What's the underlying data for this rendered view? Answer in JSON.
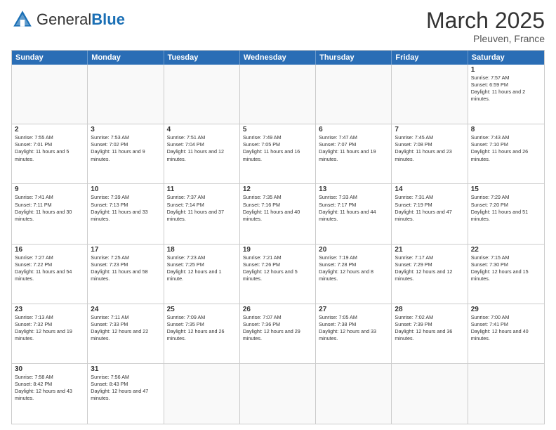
{
  "header": {
    "logo_general": "General",
    "logo_blue": "Blue",
    "month": "March 2025",
    "location": "Pleuven, France"
  },
  "days_of_week": [
    "Sunday",
    "Monday",
    "Tuesday",
    "Wednesday",
    "Thursday",
    "Friday",
    "Saturday"
  ],
  "weeks": [
    [
      {
        "day": "",
        "text": ""
      },
      {
        "day": "",
        "text": ""
      },
      {
        "day": "",
        "text": ""
      },
      {
        "day": "",
        "text": ""
      },
      {
        "day": "",
        "text": ""
      },
      {
        "day": "",
        "text": ""
      },
      {
        "day": "1",
        "text": "Sunrise: 7:57 AM\nSunset: 6:59 PM\nDaylight: 11 hours and 2 minutes."
      }
    ],
    [
      {
        "day": "2",
        "text": "Sunrise: 7:55 AM\nSunset: 7:01 PM\nDaylight: 11 hours and 5 minutes."
      },
      {
        "day": "3",
        "text": "Sunrise: 7:53 AM\nSunset: 7:02 PM\nDaylight: 11 hours and 9 minutes."
      },
      {
        "day": "4",
        "text": "Sunrise: 7:51 AM\nSunset: 7:04 PM\nDaylight: 11 hours and 12 minutes."
      },
      {
        "day": "5",
        "text": "Sunrise: 7:49 AM\nSunset: 7:05 PM\nDaylight: 11 hours and 16 minutes."
      },
      {
        "day": "6",
        "text": "Sunrise: 7:47 AM\nSunset: 7:07 PM\nDaylight: 11 hours and 19 minutes."
      },
      {
        "day": "7",
        "text": "Sunrise: 7:45 AM\nSunset: 7:08 PM\nDaylight: 11 hours and 23 minutes."
      },
      {
        "day": "8",
        "text": "Sunrise: 7:43 AM\nSunset: 7:10 PM\nDaylight: 11 hours and 26 minutes."
      }
    ],
    [
      {
        "day": "9",
        "text": "Sunrise: 7:41 AM\nSunset: 7:11 PM\nDaylight: 11 hours and 30 minutes."
      },
      {
        "day": "10",
        "text": "Sunrise: 7:39 AM\nSunset: 7:13 PM\nDaylight: 11 hours and 33 minutes."
      },
      {
        "day": "11",
        "text": "Sunrise: 7:37 AM\nSunset: 7:14 PM\nDaylight: 11 hours and 37 minutes."
      },
      {
        "day": "12",
        "text": "Sunrise: 7:35 AM\nSunset: 7:16 PM\nDaylight: 11 hours and 40 minutes."
      },
      {
        "day": "13",
        "text": "Sunrise: 7:33 AM\nSunset: 7:17 PM\nDaylight: 11 hours and 44 minutes."
      },
      {
        "day": "14",
        "text": "Sunrise: 7:31 AM\nSunset: 7:19 PM\nDaylight: 11 hours and 47 minutes."
      },
      {
        "day": "15",
        "text": "Sunrise: 7:29 AM\nSunset: 7:20 PM\nDaylight: 11 hours and 51 minutes."
      }
    ],
    [
      {
        "day": "16",
        "text": "Sunrise: 7:27 AM\nSunset: 7:22 PM\nDaylight: 11 hours and 54 minutes."
      },
      {
        "day": "17",
        "text": "Sunrise: 7:25 AM\nSunset: 7:23 PM\nDaylight: 11 hours and 58 minutes."
      },
      {
        "day": "18",
        "text": "Sunrise: 7:23 AM\nSunset: 7:25 PM\nDaylight: 12 hours and 1 minute."
      },
      {
        "day": "19",
        "text": "Sunrise: 7:21 AM\nSunset: 7:26 PM\nDaylight: 12 hours and 5 minutes."
      },
      {
        "day": "20",
        "text": "Sunrise: 7:19 AM\nSunset: 7:28 PM\nDaylight: 12 hours and 8 minutes."
      },
      {
        "day": "21",
        "text": "Sunrise: 7:17 AM\nSunset: 7:29 PM\nDaylight: 12 hours and 12 minutes."
      },
      {
        "day": "22",
        "text": "Sunrise: 7:15 AM\nSunset: 7:30 PM\nDaylight: 12 hours and 15 minutes."
      }
    ],
    [
      {
        "day": "23",
        "text": "Sunrise: 7:13 AM\nSunset: 7:32 PM\nDaylight: 12 hours and 19 minutes."
      },
      {
        "day": "24",
        "text": "Sunrise: 7:11 AM\nSunset: 7:33 PM\nDaylight: 12 hours and 22 minutes."
      },
      {
        "day": "25",
        "text": "Sunrise: 7:09 AM\nSunset: 7:35 PM\nDaylight: 12 hours and 26 minutes."
      },
      {
        "day": "26",
        "text": "Sunrise: 7:07 AM\nSunset: 7:36 PM\nDaylight: 12 hours and 29 minutes."
      },
      {
        "day": "27",
        "text": "Sunrise: 7:05 AM\nSunset: 7:38 PM\nDaylight: 12 hours and 33 minutes."
      },
      {
        "day": "28",
        "text": "Sunrise: 7:02 AM\nSunset: 7:39 PM\nDaylight: 12 hours and 36 minutes."
      },
      {
        "day": "29",
        "text": "Sunrise: 7:00 AM\nSunset: 7:41 PM\nDaylight: 12 hours and 40 minutes."
      }
    ],
    [
      {
        "day": "30",
        "text": "Sunrise: 7:58 AM\nSunset: 8:42 PM\nDaylight: 12 hours and 43 minutes."
      },
      {
        "day": "31",
        "text": "Sunrise: 7:56 AM\nSunset: 8:43 PM\nDaylight: 12 hours and 47 minutes."
      },
      {
        "day": "",
        "text": ""
      },
      {
        "day": "",
        "text": ""
      },
      {
        "day": "",
        "text": ""
      },
      {
        "day": "",
        "text": ""
      },
      {
        "day": "",
        "text": ""
      }
    ]
  ]
}
